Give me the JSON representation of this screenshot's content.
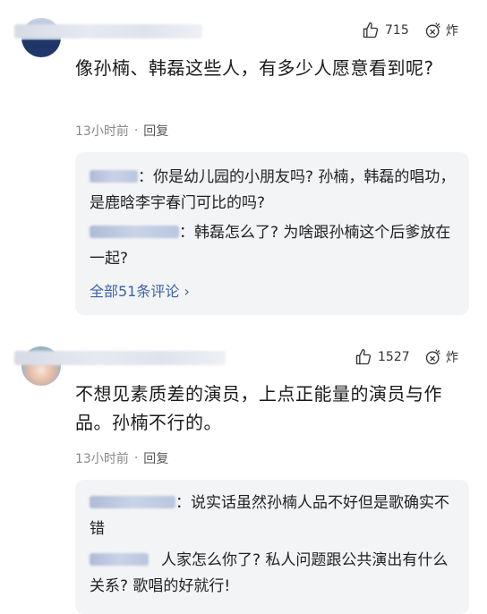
{
  "comments": [
    {
      "likes": "715",
      "reaction_label": "炸",
      "text": "像孙楠、韩磊这些人，有多少人愿意看到呢?",
      "time": "13小时前",
      "reply_label": "回复",
      "replies": [
        {
          "text": "你是幼儿园的小朋友吗? 孙楠，韩磊的唱功，是鹿晗李宇春门可比的吗?"
        },
        {
          "text": "韩磊怎么了? 为啥跟孙楠这个后爹放在一起?"
        }
      ],
      "all_replies_label": "全部51条评论 ›"
    },
    {
      "likes": "1527",
      "reaction_label": "炸",
      "text": "不想见素质差的演员，上点正能量的演员与作品。孙楠不行的。",
      "time": "13小时前",
      "reply_label": "回复",
      "replies": [
        {
          "text": "说实话虽然孙楠人品不好但是歌确实不错"
        },
        {
          "text": "人家怎么你了? 私人问题跟公共演出有什么关系? 歌唱的好就行!"
        }
      ]
    }
  ],
  "separator": "·",
  "colon": "："
}
